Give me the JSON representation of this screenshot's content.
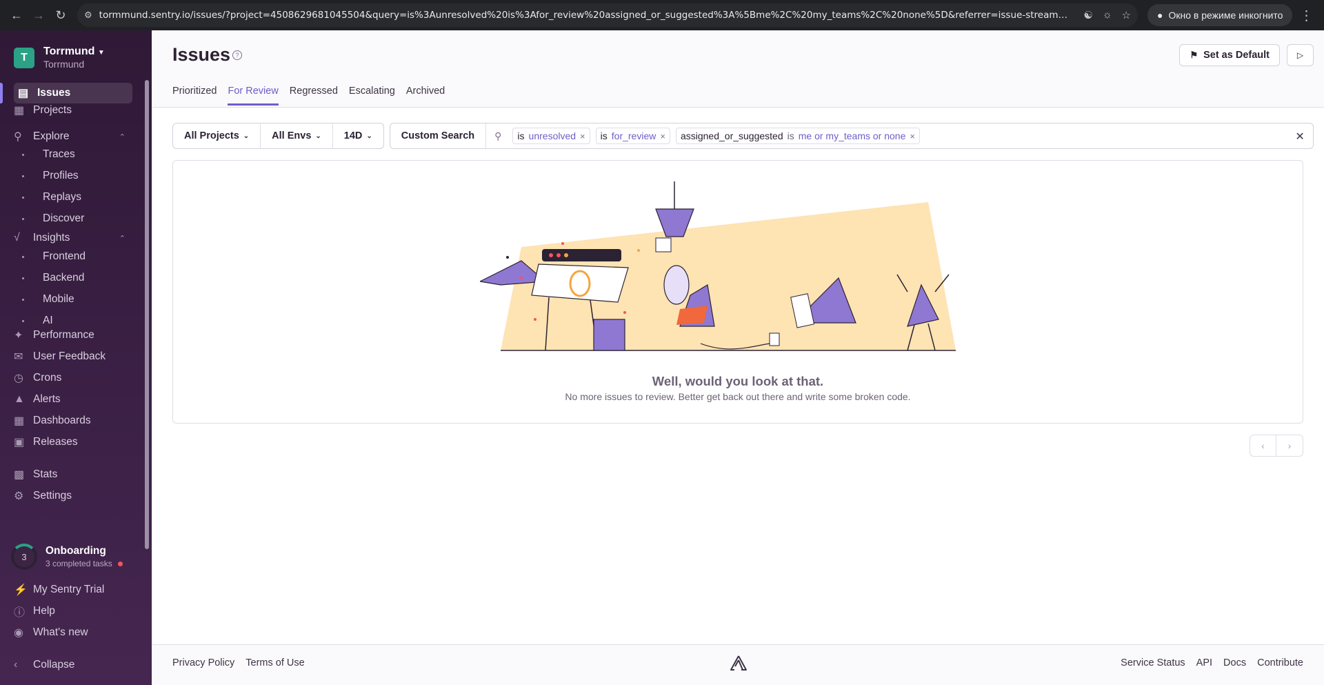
{
  "browser": {
    "url": "tormmund.sentry.io/issues/?project=4508629681045504&query=is%3Aunresolved%20is%3Afor_review%20assigned_or_suggested%3A%5Bme%2C%20my_teams%2C%20none%5D&referrer=issue-stream&sort=inbox&statsPeri...",
    "incognito_label": "Окно в режиме инкогнито"
  },
  "org": {
    "avatar_letter": "T",
    "name": "Torrmund",
    "sub": "Torrmund"
  },
  "sidebar": {
    "issues": "Issues",
    "projects": "Projects",
    "explore": "Explore",
    "explore_items": [
      "Traces",
      "Profiles",
      "Replays",
      "Discover"
    ],
    "insights": "Insights",
    "insights_items": [
      "Frontend",
      "Backend",
      "Mobile",
      "AI"
    ],
    "performance": "Performance",
    "user_feedback": "User Feedback",
    "crons": "Crons",
    "alerts": "Alerts",
    "dashboards": "Dashboards",
    "releases": "Releases",
    "stats": "Stats",
    "settings": "Settings",
    "onboarding": {
      "count": "3",
      "title": "Onboarding",
      "sub": "3 completed tasks"
    },
    "trial": "My Sentry Trial",
    "help": "Help",
    "whats_new": "What's new",
    "collapse": "Collapse"
  },
  "header": {
    "title": "Issues",
    "set_default": "Set as Default",
    "tabs": [
      "Prioritized",
      "For Review",
      "Regressed",
      "Escalating",
      "Archived"
    ],
    "active_tab": "For Review"
  },
  "filters": {
    "projects": "All Projects",
    "envs": "All Envs",
    "period": "14D",
    "custom_search": "Custom Search",
    "tokens": [
      {
        "key": "is",
        "op": "",
        "value": "unresolved"
      },
      {
        "key": "is",
        "op": "",
        "value": "for_review"
      },
      {
        "key": "assigned_or_suggested",
        "op": "is",
        "value": "me or my_teams or none"
      }
    ]
  },
  "empty_state": {
    "title": "Well, would you look at that.",
    "subtitle": "No more issues to review. Better get back out there and write some broken code."
  },
  "footer": {
    "left": [
      "Privacy Policy",
      "Terms of Use"
    ],
    "right": [
      "Service Status",
      "API",
      "Docs",
      "Contribute"
    ]
  },
  "colors": {
    "accent": "#6c5fc7",
    "sidebar_top": "#2f1937",
    "sidebar_bottom": "#452650",
    "org_avatar": "#2ba185"
  }
}
